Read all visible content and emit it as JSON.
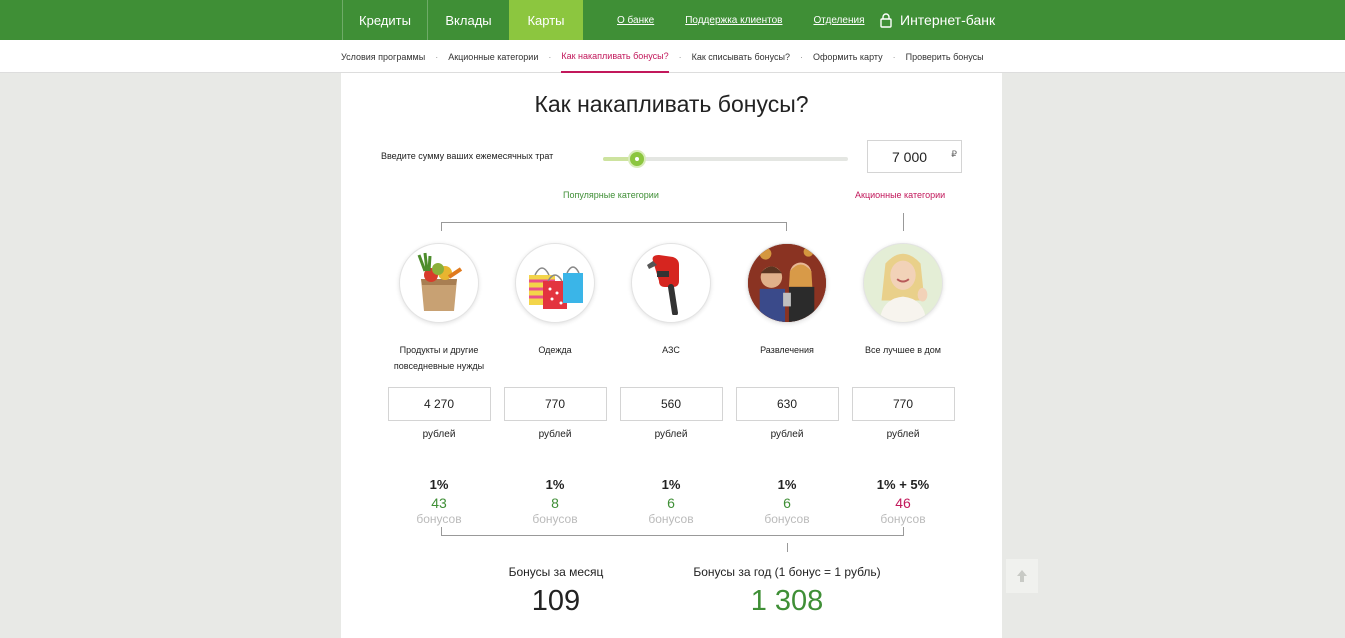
{
  "topnav": {
    "tabs": [
      "Кредиты",
      "Вклады",
      "Карты"
    ],
    "active_tab": "Карты",
    "links": [
      "О банке",
      "Поддержка клиентов",
      "Отделения"
    ],
    "internet_bank": "Интернет-банк"
  },
  "subnav": {
    "items": [
      "Условия программы",
      "Акционные категории",
      "Как накапливать бонусы?",
      "Как списывать бонусы?",
      "Оформить карту",
      "Проверить бонусы"
    ],
    "active": "Как накапливать бонусы?"
  },
  "calculator": {
    "title": "Как накапливать бонусы?",
    "slider_label": "Введите сумму ваших ежемесячных трат",
    "slider_level": 0.14,
    "amount": "7 000",
    "currency": "₽",
    "popular_label": "Популярные категории",
    "promo_label": "Акционные категории",
    "categories": [
      {
        "label": "Продукты и другие повседневные нужды",
        "value": "4 270",
        "unit": "рублей",
        "percent": "1%",
        "bonus": "43",
        "bonus_word": "бонусов",
        "icon": "groceries-bag-icon"
      },
      {
        "label": "Одежда",
        "value": "770",
        "unit": "рублей",
        "percent": "1%",
        "bonus": "8",
        "bonus_word": "бонусов",
        "icon": "shopping-bags-icon"
      },
      {
        "label": "АЗС",
        "value": "560",
        "unit": "рублей",
        "percent": "1%",
        "bonus": "6",
        "bonus_word": "бонусов",
        "icon": "fuel-nozzle-icon"
      },
      {
        "label": "Развлечения",
        "value": "630",
        "unit": "рублей",
        "percent": "1%",
        "bonus": "6",
        "bonus_word": "бонусов",
        "icon": "cinema-people-icon"
      },
      {
        "label": "Все лучшее в дом",
        "value": "770",
        "unit": "рублей",
        "percent": "1% + 5%",
        "bonus": "46",
        "bonus_word": "бонусов",
        "icon": "smiling-woman-icon"
      }
    ],
    "month_label": "Бонусы за месяц",
    "month_value": "109",
    "year_label": "Бонусы за год (1 бонус = 1 рубль)",
    "year_value": "1 308"
  },
  "colors": {
    "brand_green": "#3f8f36",
    "accent_green": "#8cc63f",
    "promo_pink": "#c2185b"
  }
}
